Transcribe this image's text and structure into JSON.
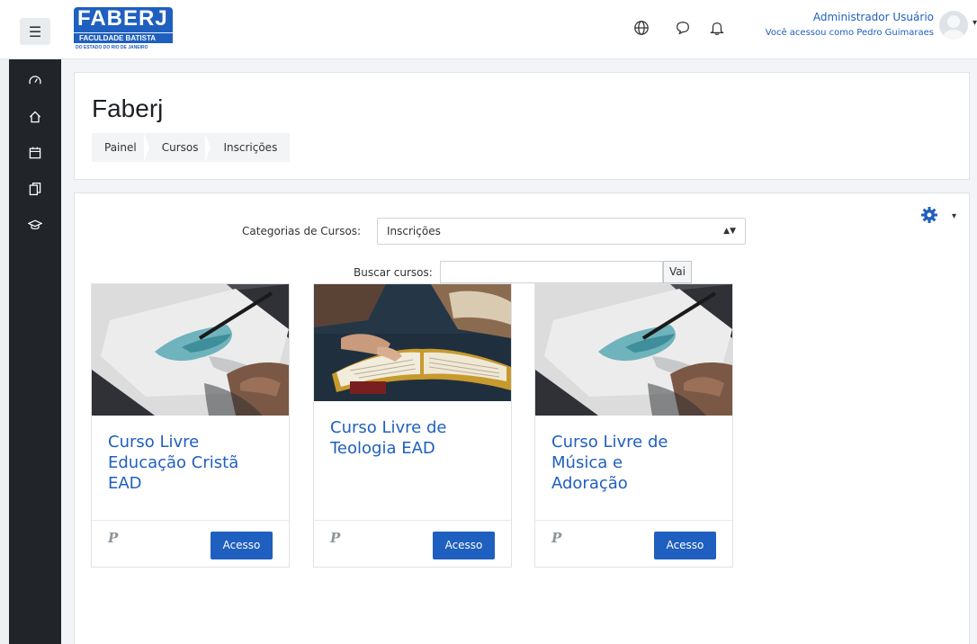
{
  "navbar": {
    "menu_icon": "hamburger-icon",
    "logo": {
      "main": "FABERJ",
      "band": "FACULDADE BATISTA",
      "sub": "DO ESTADO DO RIO DE JANEIRO"
    },
    "icons": [
      "globe-icon",
      "chat-icon",
      "bell-icon"
    ],
    "user": {
      "name": "Administrador Usuário",
      "logged_as": "Você acessou como Pedro Guimaraes"
    }
  },
  "sidebar": {
    "items": [
      {
        "icon": "dashboard-icon"
      },
      {
        "icon": "home-icon"
      },
      {
        "icon": "calendar-icon"
      },
      {
        "icon": "files-icon"
      },
      {
        "icon": "graduation-cap-icon"
      }
    ]
  },
  "header": {
    "title": "Faberj",
    "breadcrumb": [
      "Painel",
      "Cursos",
      "Inscrições"
    ]
  },
  "main": {
    "category_label": "Categorias de Cursos:",
    "category_value": "Inscrições",
    "search_label": "Buscar cursos:",
    "search_value": "",
    "search_button": "Vai",
    "courses": [
      {
        "title": "Curso Livre Educação Cristã EAD",
        "button": "Acesso",
        "payment_icon": "paypal-icon"
      },
      {
        "title": "Curso Livre de Teologia EAD",
        "button": "Acesso",
        "payment_icon": "paypal-icon"
      },
      {
        "title": "Curso Livre de Música e Adoração",
        "button": "Acesso",
        "payment_icon": "paypal-icon"
      }
    ]
  },
  "colors": {
    "primary": "#1f5fbf",
    "sidebar": "#212529",
    "background": "#f2f4f7"
  }
}
